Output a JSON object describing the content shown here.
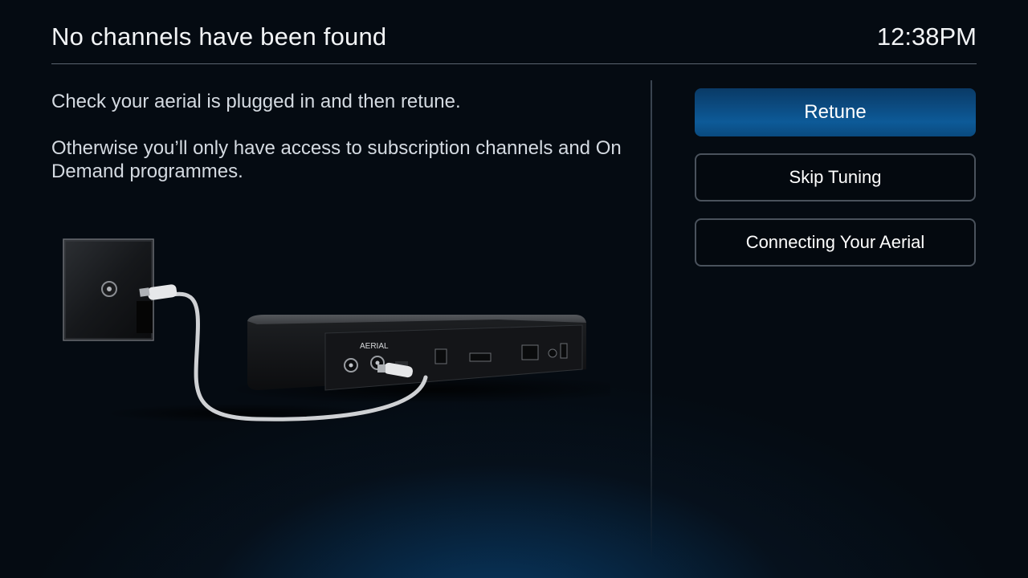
{
  "header": {
    "title": "No channels have been found",
    "clock": "12:38PM"
  },
  "message": {
    "line1": "Check your aerial is plugged in and then retune.",
    "line2": "Otherwise you’ll only have access to subscription channels and On Demand programmes."
  },
  "illustration": {
    "box_label": "AERIAL"
  },
  "actions": [
    {
      "label": "Retune",
      "focused": true
    },
    {
      "label": "Skip Tuning",
      "focused": false
    },
    {
      "label": "Connecting Your Aerial",
      "focused": false
    }
  ],
  "colors": {
    "focus_button": "#0d5a98",
    "background": "#050b12"
  }
}
